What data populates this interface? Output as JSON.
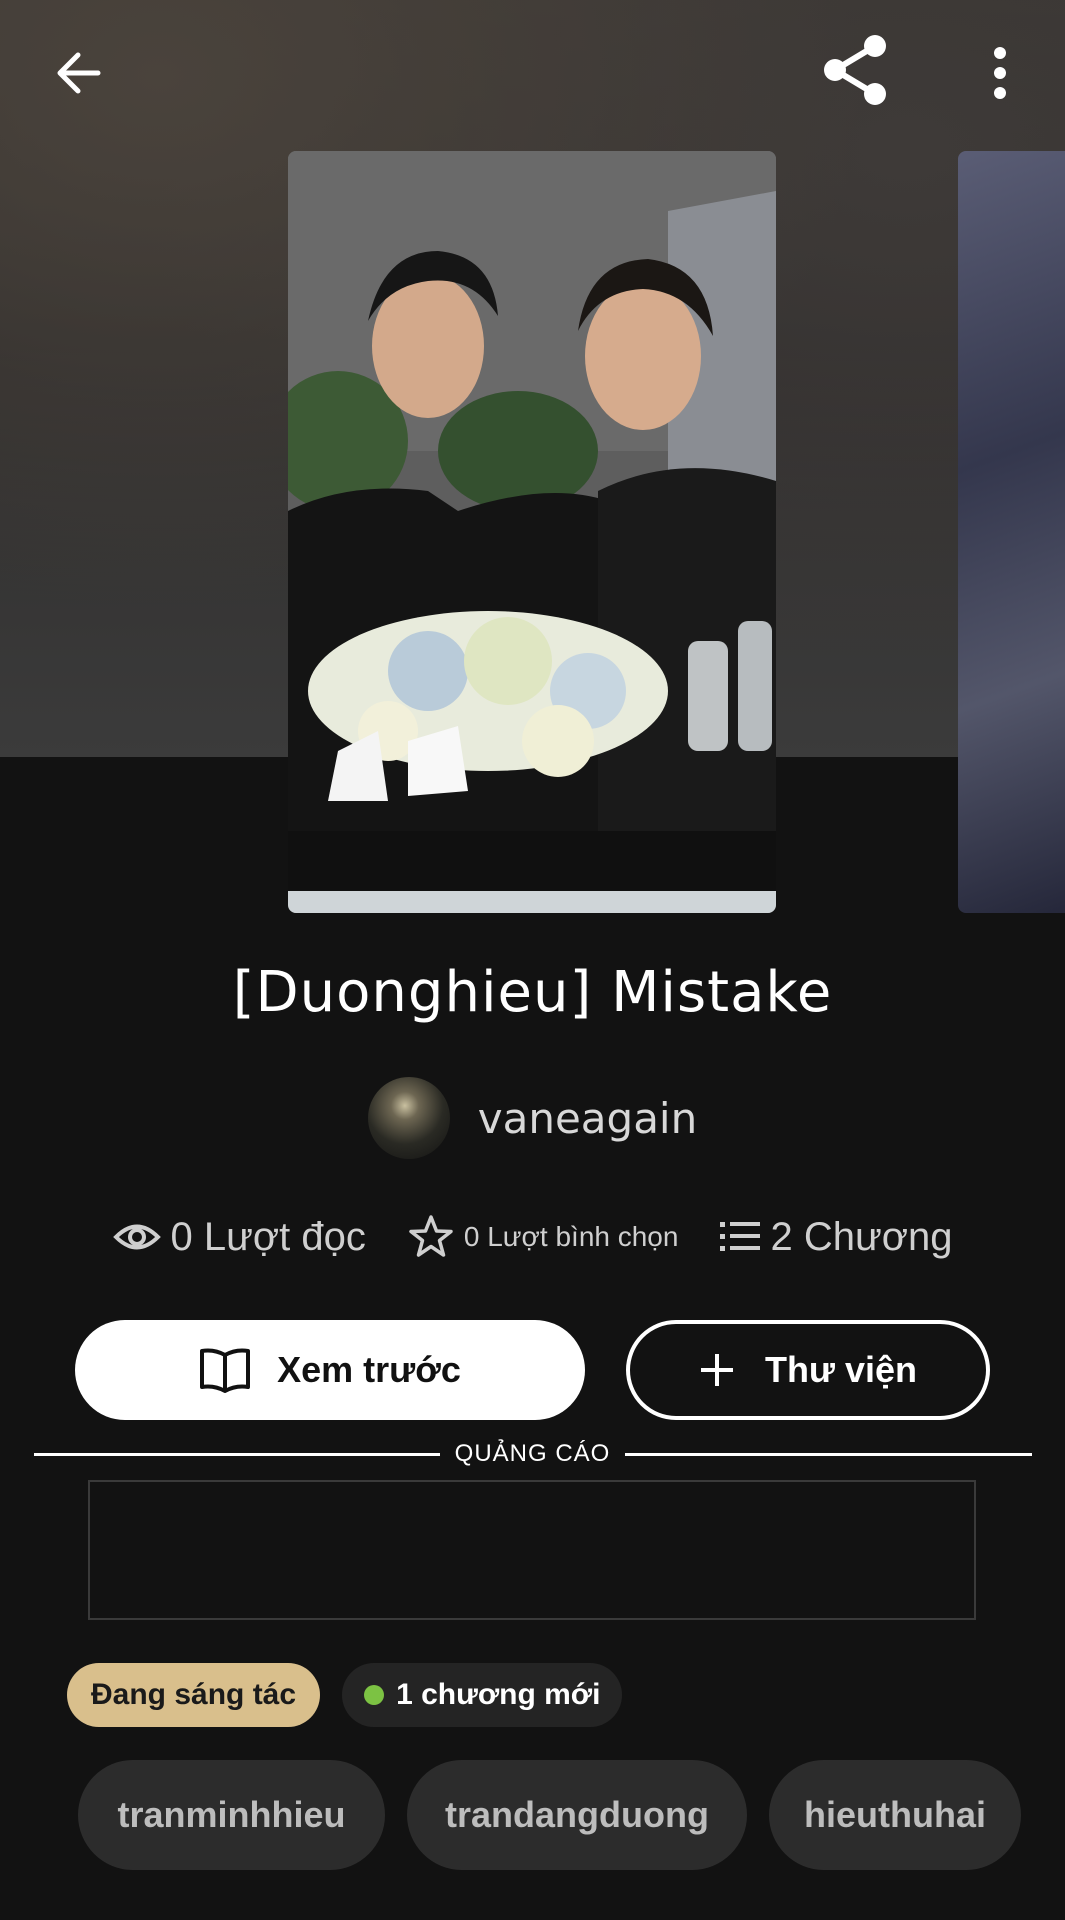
{
  "story": {
    "title": "[Duonghieu] Mistake",
    "author": "vaneagain"
  },
  "stats": {
    "reads": "0 Lượt đọc",
    "votes": "0 Lượt bình chọn",
    "chapters": "2 Chương"
  },
  "actions": {
    "preview_label": "Xem trước",
    "library_label": "Thư viện"
  },
  "ad": {
    "label": "QUẢNG CÁO"
  },
  "badges": {
    "status": "Đang sáng tác",
    "new_chapters": "1 chương mới"
  },
  "tags": [
    "tranminhhieu",
    "trandangduong",
    "hieuthuhai"
  ],
  "icons": {
    "back": "arrow-left-icon",
    "share": "share-icon",
    "more": "more-vertical-icon",
    "reads": "eye-icon",
    "votes": "star-icon",
    "chapters": "list-icon",
    "preview": "book-open-icon",
    "library": "plus-icon"
  },
  "colors": {
    "background": "#121212",
    "status_badge": "#d9bf8c",
    "new_dot": "#7cc243",
    "tag_bg": "#2c2c2c"
  }
}
